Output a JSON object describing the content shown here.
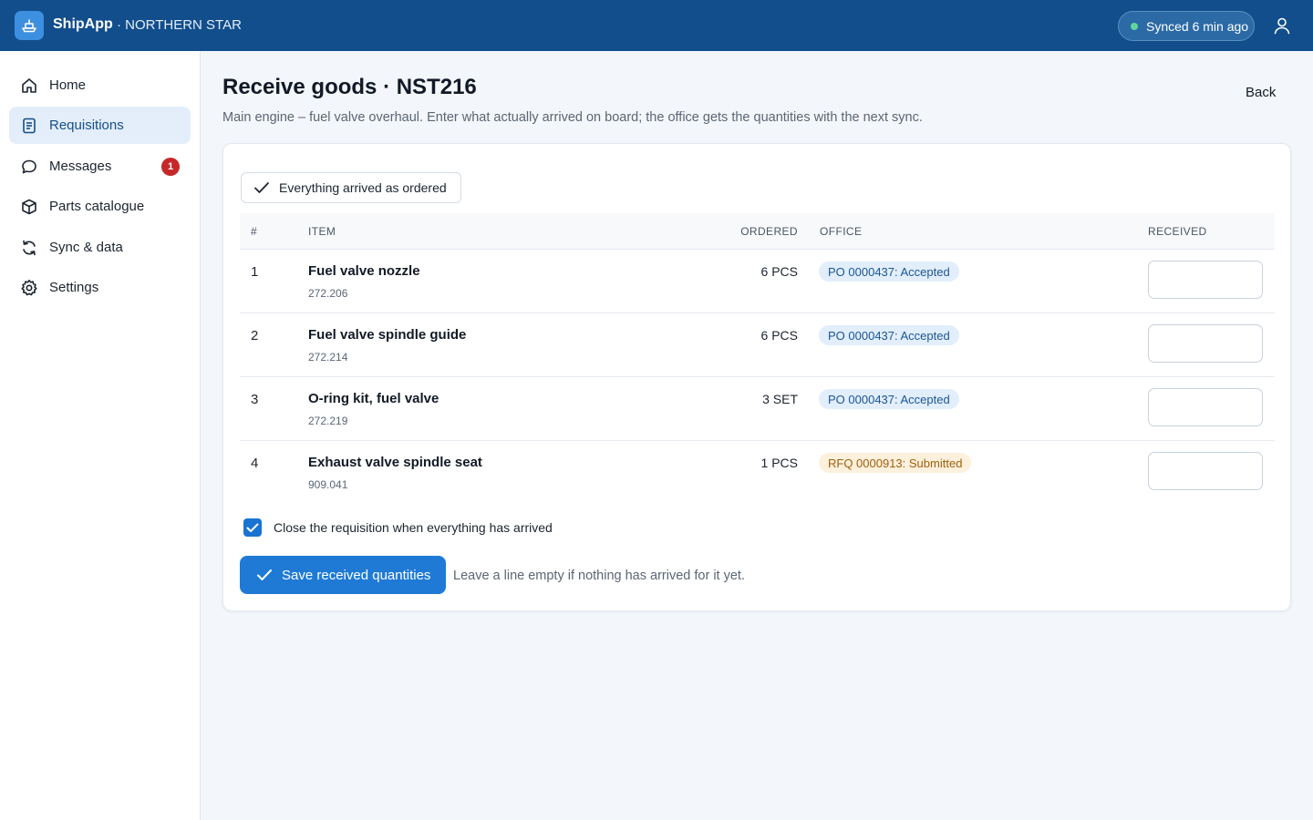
{
  "header": {
    "app_name": "ShipApp",
    "vessel": "· NORTHERN STAR",
    "sync_status": "Synced 6 min ago",
    "icons": {
      "logo": "ship-icon",
      "user": "user-icon",
      "sync": "green-dot"
    },
    "colors": {
      "bar": "#124e8c",
      "sync_dot": "#5fd69a"
    }
  },
  "sidebar": {
    "items": [
      {
        "label": "Home",
        "icon": "home-icon",
        "active": false
      },
      {
        "label": "Requisitions",
        "icon": "document-icon",
        "active": true
      },
      {
        "label": "Messages",
        "icon": "chat-icon",
        "active": false,
        "badge": "1"
      },
      {
        "label": "Parts catalogue",
        "icon": "box-icon",
        "active": false
      },
      {
        "label": "Sync & data",
        "icon": "sync-icon",
        "active": false
      },
      {
        "label": "Settings",
        "icon": "gear-icon",
        "active": false
      }
    ]
  },
  "page": {
    "title": "Receive goods · NST216",
    "subtitle": "Main engine – fuel valve overhaul. Enter what actually arrived on board; the office gets the quantities with the next sync.",
    "back_label": "Back"
  },
  "card": {
    "all_arrived_label": "Everything arrived as ordered",
    "columns": {
      "num": "#",
      "item": "ITEM",
      "ordered": "ORDERED",
      "office": "OFFICE",
      "received": "RECEIVED"
    },
    "rows": [
      {
        "num": "1",
        "name": "Fuel valve nozzle",
        "code": "272.206",
        "ordered": "6 PCS",
        "office": "PO 0000437: Accepted",
        "status": "accepted",
        "received": ""
      },
      {
        "num": "2",
        "name": "Fuel valve spindle guide",
        "code": "272.214",
        "ordered": "6 PCS",
        "office": "PO 0000437: Accepted",
        "status": "accepted",
        "received": ""
      },
      {
        "num": "3",
        "name": "O-ring kit, fuel valve",
        "code": "272.219",
        "ordered": "3 SET",
        "office": "PO 0000437: Accepted",
        "status": "accepted",
        "received": ""
      },
      {
        "num": "4",
        "name": "Exhaust valve spindle seat",
        "code": "909.041",
        "ordered": "1 PCS",
        "office": "RFQ 0000913: Submitted",
        "status": "submitted",
        "received": ""
      }
    ],
    "close_requisition_label": "Close the requisition when everything has arrived",
    "close_requisition_checked": true,
    "save_label": "Save received quantities",
    "save_hint": "Leave a line empty if nothing has arrived for it yet.",
    "colors": {
      "primary": "#1f7ad6",
      "accepted_bg": "#e2eefb",
      "submitted_bg": "#fdf0dc"
    }
  }
}
